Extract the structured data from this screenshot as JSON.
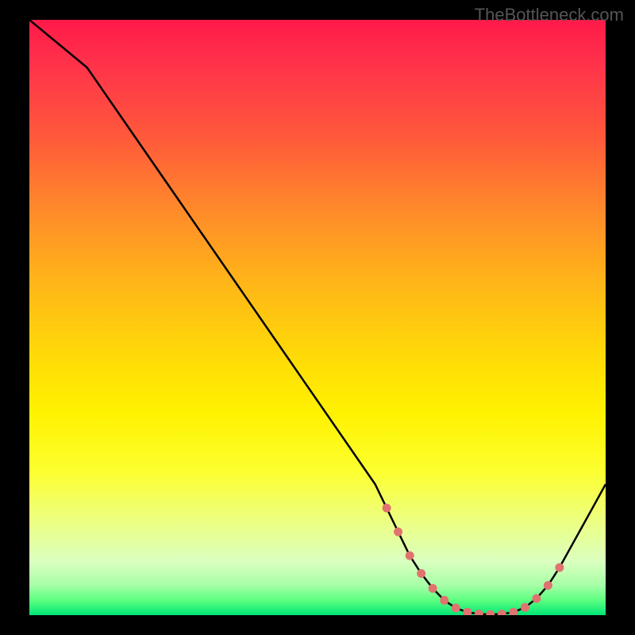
{
  "watermark": "TheBottleneck.com",
  "chart_data": {
    "type": "line",
    "title": "",
    "xlabel": "",
    "ylabel": "",
    "xlim": [
      0,
      100
    ],
    "ylim": [
      0,
      100
    ],
    "series": [
      {
        "name": "curve",
        "x": [
          0,
          5,
          10,
          15,
          20,
          25,
          30,
          35,
          40,
          45,
          50,
          55,
          60,
          62,
          64,
          66,
          68,
          70,
          72,
          74,
          76,
          78,
          80,
          82,
          84,
          86,
          88,
          90,
          92,
          94,
          96,
          98,
          100
        ],
        "y": [
          100,
          96,
          92,
          85,
          78,
          71,
          64,
          57,
          50,
          43,
          36,
          29,
          22,
          18,
          14,
          10,
          7,
          4.5,
          2.5,
          1.2,
          0.5,
          0.2,
          0.1,
          0.2,
          0.5,
          1.3,
          2.8,
          5,
          8,
          11.5,
          15,
          18.5,
          22
        ]
      }
    ],
    "markers": {
      "x": [
        62,
        64,
        66,
        68,
        70,
        72,
        74,
        76,
        78,
        80,
        82,
        84,
        86,
        88,
        90,
        92
      ],
      "y": [
        18,
        14,
        10,
        7,
        4.5,
        2.5,
        1.2,
        0.5,
        0.2,
        0.1,
        0.2,
        0.5,
        1.3,
        2.8,
        5,
        8
      ],
      "color": "#e0736e"
    },
    "gradient_stops": [
      {
        "pct": 0,
        "color": "#ff1a4a"
      },
      {
        "pct": 20,
        "color": "#ff5a3a"
      },
      {
        "pct": 44,
        "color": "#ffb518"
      },
      {
        "pct": 66,
        "color": "#fff200"
      },
      {
        "pct": 91,
        "color": "#daffc0"
      },
      {
        "pct": 100,
        "color": "#00e676"
      }
    ]
  }
}
